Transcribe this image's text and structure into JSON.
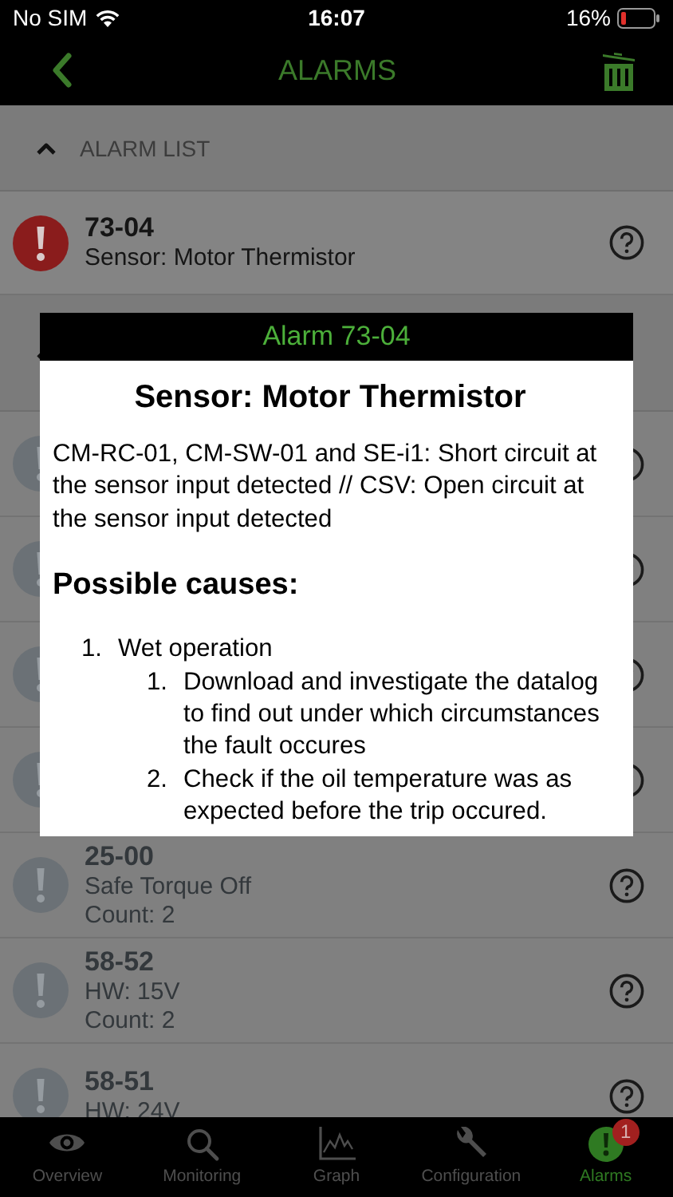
{
  "status_bar": {
    "carrier": "No SIM",
    "time": "16:07",
    "battery": "16%"
  },
  "nav": {
    "title": "ALARMS"
  },
  "sections": [
    {
      "title": "ALARM LIST",
      "expanded": true,
      "alarms": [
        {
          "kind": "active",
          "code": "73-04",
          "description": "Sensor: Motor Thermistor"
        }
      ]
    },
    {
      "expanded": true,
      "alarms": [
        {
          "kind": "covered"
        },
        {
          "kind": "covered"
        },
        {
          "kind": "covered"
        },
        {
          "kind": "covered"
        },
        {
          "kind": "inactive",
          "code": "25-00",
          "description": "Safe Torque Off",
          "count": "Count: 2"
        },
        {
          "kind": "inactive",
          "code": "58-52",
          "description": "HW: 15V",
          "count": "Count: 2"
        },
        {
          "kind": "inactive",
          "code": "58-51",
          "description": "HW: 24V"
        }
      ]
    }
  ],
  "dialog": {
    "title": "Alarm 73-04",
    "heading": "Sensor: Motor Thermistor",
    "description": "CM-RC-01, CM-SW-01 and SE-i1: Short circuit at the sensor input detected // CSV: Open circuit at the sensor input detected",
    "causes_heading": "Possible causes:",
    "causes": [
      {
        "number": "1.",
        "text": "Wet operation",
        "children": [
          {
            "number": "1.",
            "text": "Download and investigate the datalog to find out under which circumstances the fault occures"
          },
          {
            "number": "2.",
            "text": "Check if the oil temperature was as expected before the trip occured."
          }
        ]
      }
    ]
  },
  "tabs": [
    {
      "label": "Overview",
      "selected": false
    },
    {
      "label": "Monitoring",
      "selected": false
    },
    {
      "label": "Graph",
      "selected": false
    },
    {
      "label": "Configuration",
      "selected": false
    },
    {
      "label": "Alarms",
      "selected": true,
      "badge": "1"
    }
  ]
}
